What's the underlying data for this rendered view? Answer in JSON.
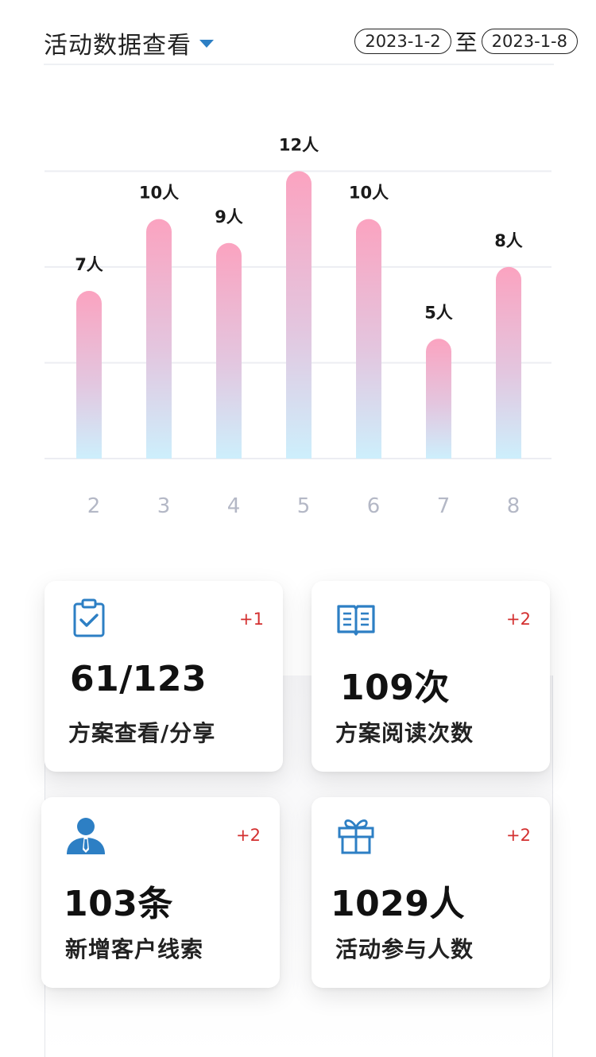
{
  "header": {
    "title": "活动数据查看",
    "start_date": "2023-1-2",
    "date_separator": "至",
    "end_date": "2023-1-8"
  },
  "chart_data": {
    "type": "bar",
    "categories": [
      "2",
      "3",
      "4",
      "5",
      "6",
      "7",
      "8"
    ],
    "values": [
      7,
      10,
      9,
      12,
      10,
      5,
      8
    ],
    "value_suffix": "人",
    "ylim": [
      0,
      14.5
    ],
    "grid": true,
    "colors": {
      "bar_top": "#fba3c0",
      "bar_bottom": "#cdeffc",
      "grid": "#ecedf2",
      "tick": "#b4b8c6"
    }
  },
  "cards": [
    {
      "icon": "clipboard-check-icon",
      "delta": "+1",
      "value": "61/123",
      "label": "方案查看/分享"
    },
    {
      "icon": "open-book-icon",
      "delta": "+2",
      "value": "109次",
      "label": "方案阅读次数"
    },
    {
      "icon": "user-tie-icon",
      "delta": "+2",
      "value": "103条",
      "label": "新增客户线索"
    },
    {
      "icon": "gift-icon",
      "delta": "+2",
      "value": "1029人",
      "label": "活动参与人数"
    }
  ],
  "colors": {
    "accent": "#2d7fc4",
    "delta": "#d32f2f"
  }
}
